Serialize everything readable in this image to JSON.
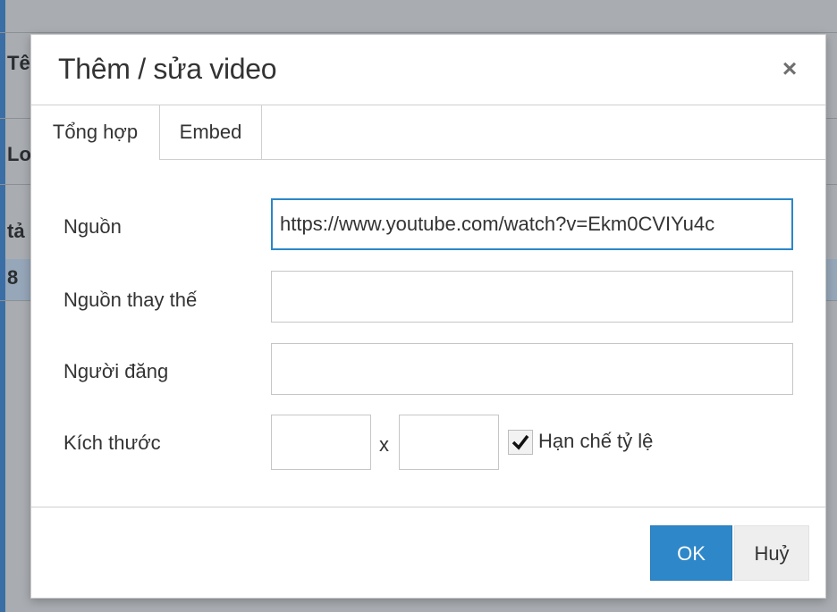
{
  "background": {
    "row_labels": [
      "Tê",
      "Lo",
      "tả",
      "8"
    ]
  },
  "dialog": {
    "title": "Thêm / sửa video",
    "close_label": "×",
    "tabs": [
      {
        "label": "Tổng hợp",
        "active": true
      },
      {
        "label": "Embed",
        "active": false
      }
    ],
    "fields": {
      "source_label": "Nguồn",
      "source_value": "https://www.youtube.com/watch?v=Ekm0CVIYu4c",
      "alt_source_label": "Nguồn thay thế",
      "alt_source_value": "",
      "poster_label": "Người đăng",
      "poster_value": "",
      "size_label": "Kích thước",
      "width_value": "",
      "height_value": "",
      "size_separator": "x",
      "constrain_label": "Hạn chế tỷ lệ",
      "constrain_checked": true
    },
    "buttons": {
      "ok_label": "OK",
      "cancel_label": "Huỷ"
    }
  },
  "colors": {
    "primary": "#2e87c8",
    "focus_border": "#2a87c8"
  }
}
